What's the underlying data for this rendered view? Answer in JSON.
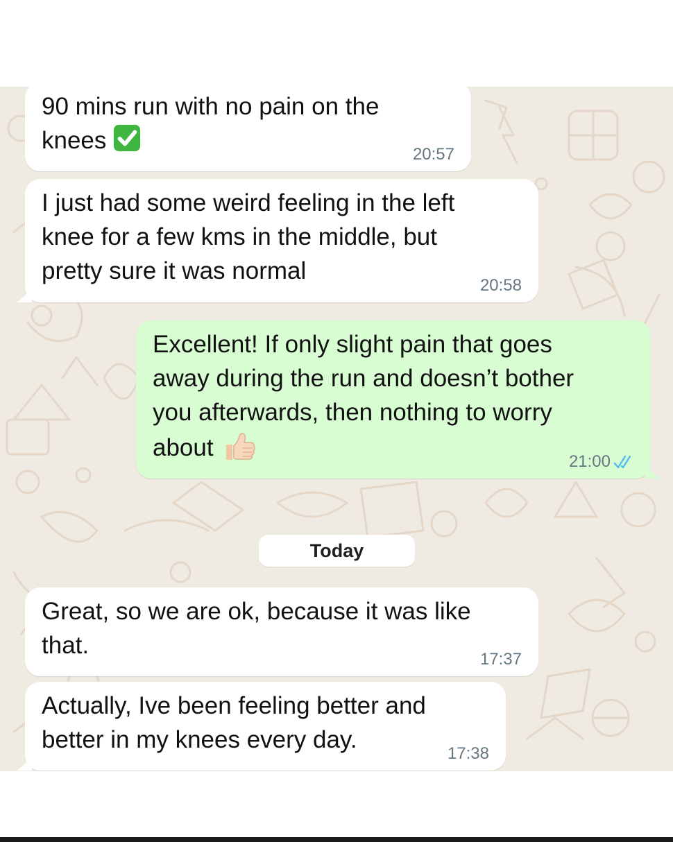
{
  "colors": {
    "wallpaper": "#efeae2",
    "incoming_bubble": "#ffffff",
    "outgoing_bubble": "#d9fdd3",
    "timestamp": "#667781",
    "read_ticks": "#53bdeb"
  },
  "messages": [
    {
      "direction": "incoming",
      "text": "90 mins run with no pain on the\nknees",
      "emoji": "check-mark-button-emoji",
      "time": "20:57"
    },
    {
      "direction": "incoming",
      "text": "I just had some weird feeling in the left\nknee for a few kms in the middle, but\npretty sure it was normal",
      "time": "20:58"
    },
    {
      "direction": "outgoing",
      "text": "Excellent! If only slight pain that goes\naway during the run and doesn’t bother\nyou afterwards, then nothing to worry\nabout",
      "emoji": "thumbs-up-emoji",
      "time": "21:00",
      "status": "read"
    },
    {
      "direction": "incoming",
      "text": "Great, so we are ok, because it was like\nthat.",
      "time": "17:37"
    },
    {
      "direction": "incoming",
      "text": "Actually, Ive been feeling better and\nbetter in my knees every day.",
      "time": "17:38"
    }
  ],
  "date_separator": "Today"
}
